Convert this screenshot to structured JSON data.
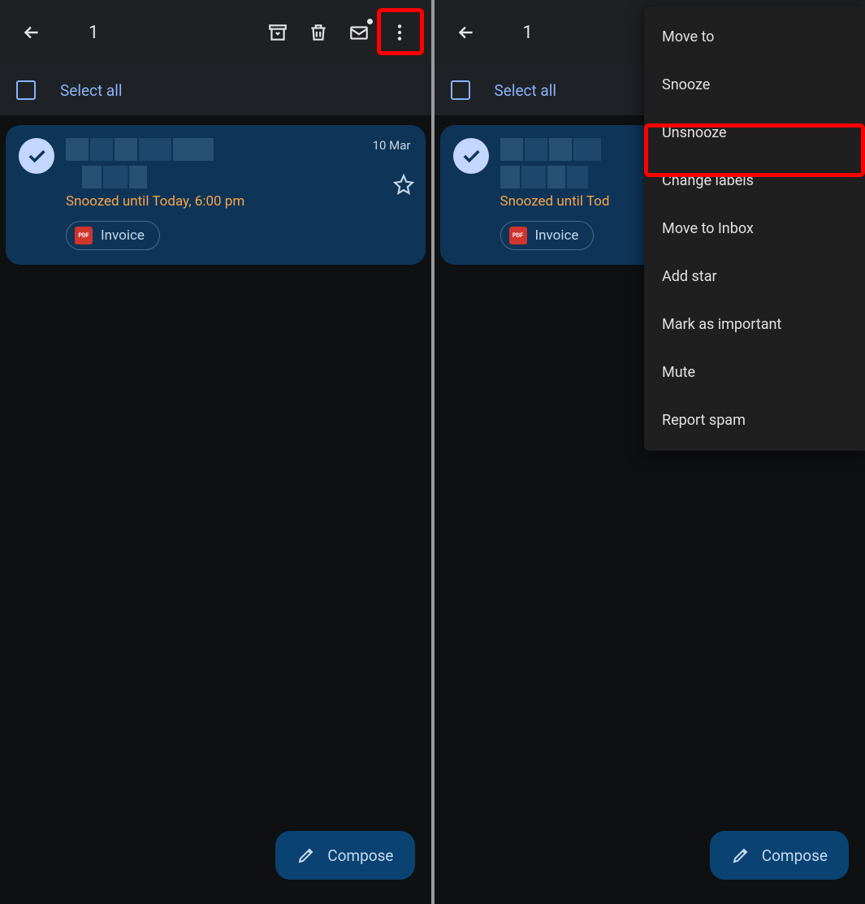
{
  "selection_count": "1",
  "select_all_label": "Select all",
  "email": {
    "date": "10 Mar",
    "snooze_text": "Snoozed until Today, 6:00 pm",
    "snooze_text_truncated": "Snoozed until Tod",
    "attachment_name": "Invoice",
    "pdf_badge": "PDF"
  },
  "compose_label": "Compose",
  "menu_items": [
    "Move to",
    "Snooze",
    "Unsnooze",
    "Change labels",
    "Move to Inbox",
    "Add star",
    "Mark as important",
    "Mute",
    "Report spam"
  ]
}
